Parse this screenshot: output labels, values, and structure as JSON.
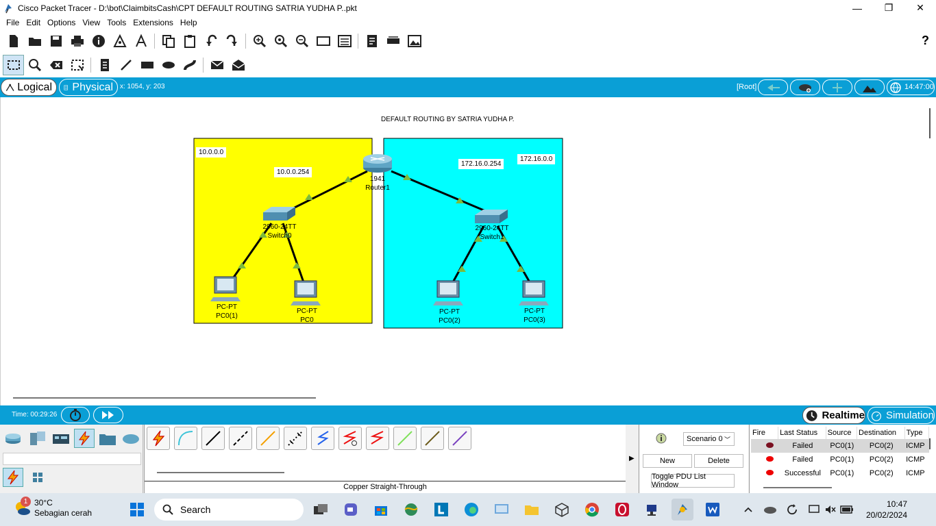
{
  "window": {
    "title": "Cisco Packet Tracer - D:\\bot\\ClaimbitsCash\\CPT DEFAULT ROUTING SATRIA YUDHA P..pkt",
    "minimize": "—",
    "maximize": "❐",
    "close": "✕"
  },
  "menu": [
    "File",
    "Edit",
    "Options",
    "View",
    "Tools",
    "Extensions",
    "Help"
  ],
  "help_icon": "?",
  "viewbar": {
    "logical": "Logical",
    "physical": "Physical",
    "coords": "x: 1054, y: 203",
    "root": "[Root]",
    "clock": "14:47:00"
  },
  "topology": {
    "title": "DEFAULT ROUTING BY SATRIA YUDHA P.",
    "zone_left_color": "#ffff00",
    "zone_right_color": "#00ffff",
    "labels": {
      "net_left": "10.0.0.0",
      "gw_left": "10.0.0.254",
      "gw_right": "172.16.0.254",
      "net_right": "172.16.0.0"
    },
    "router": {
      "model": "1941",
      "name": "Router1"
    },
    "switch0": {
      "model": "2960-24TT",
      "name": "Switch0"
    },
    "switch1": {
      "model": "2960-24TT",
      "name": "Switch1"
    },
    "pc1": {
      "model": "PC-PT",
      "name": "PC0(1)"
    },
    "pc0": {
      "model": "PC-PT",
      "name": "PC0"
    },
    "pc2": {
      "model": "PC-PT",
      "name": "PC0(2)"
    },
    "pc3": {
      "model": "PC-PT",
      "name": "PC0(3)"
    }
  },
  "status": {
    "time": "Time: 00:29:26",
    "realtime": "Realtime",
    "simulation": "Simulation"
  },
  "cable": {
    "selected_name": "Copper Straight-Through"
  },
  "scenario": {
    "selected": "Scenario 0",
    "new": "New",
    "delete": "Delete",
    "toggle": "Toggle PDU List Window"
  },
  "pdu": {
    "headers": [
      "Fire",
      "Last Status",
      "Source",
      "Destination",
      "Type"
    ],
    "rows": [
      {
        "status": "Failed",
        "source": "PC0(1)",
        "dest": "PC0(2)",
        "type": "ICMP"
      },
      {
        "status": "Failed",
        "source": "PC0(1)",
        "dest": "PC0(2)",
        "type": "ICMP"
      },
      {
        "status": "Successful",
        "source": "PC0(1)",
        "dest": "PC0(2)",
        "type": "ICMP"
      }
    ]
  },
  "taskbar": {
    "badge": "1",
    "temp": "30°C",
    "condition": "Sebagian cerah",
    "search": "Search",
    "time": "10:47",
    "date": "20/02/2024"
  }
}
